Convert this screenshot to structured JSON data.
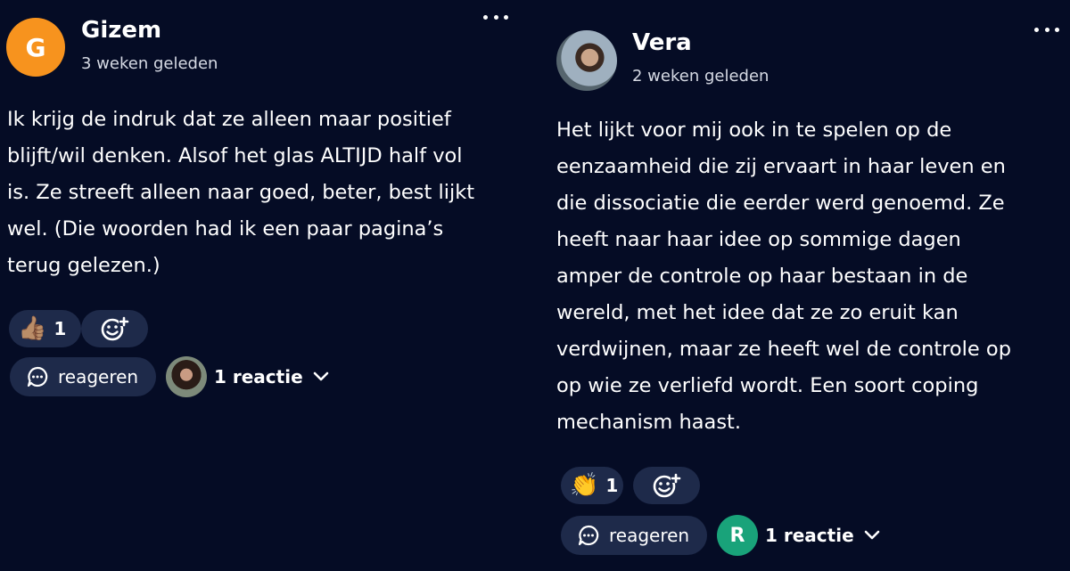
{
  "posts": [
    {
      "author": "Gizem",
      "avatar_letter": "G",
      "avatar_color": "#f7931e",
      "time": "3 weken geleden",
      "body": "Ik krijg de indruk dat ze alleen maar positief\nblijft/wil denken. Alsof het glas ALTIJD half vol\nis. Ze streeft alleen naar goed, beter, best lijkt\nwel. (Die woorden had ik een paar pagina’s\nterug gelezen.)",
      "reaction": {
        "emoji": "👍🏽",
        "count": "1"
      },
      "reply_label": "reageren",
      "replies_label": "1 reactie"
    },
    {
      "author": "Vera",
      "time": "2 weken geleden",
      "body": "Het lijkt voor mij ook in te spelen op de\neenzaamheid die zij ervaart in haar leven en\ndie dissociatie die eerder werd genoemd. Ze\nheeft naar haar idee op sommige dagen\namper de controle op haar bestaan in de\nwereld, met het idee dat ze zo eruit kan\nverdwijnen, maar ze heeft wel de controle op\nop wie ze verliefd wordt. Een soort coping\nmechanism haast.",
      "reaction": {
        "emoji": "👏",
        "count": "1"
      },
      "reply_label": "reageren",
      "replies_label": "1 reactie",
      "replier_letter": "R",
      "replier_color": "#19a37a"
    }
  ],
  "colors": {
    "background": "#050c25",
    "pill": "#1e2a4a",
    "text": "#ffffff",
    "muted": "#d6dae4"
  },
  "icons": {
    "more": "more-dots-icon",
    "add_reaction": "add-emoji-icon",
    "reply": "chat-bubble-icon",
    "expand": "chevron-down-icon"
  }
}
